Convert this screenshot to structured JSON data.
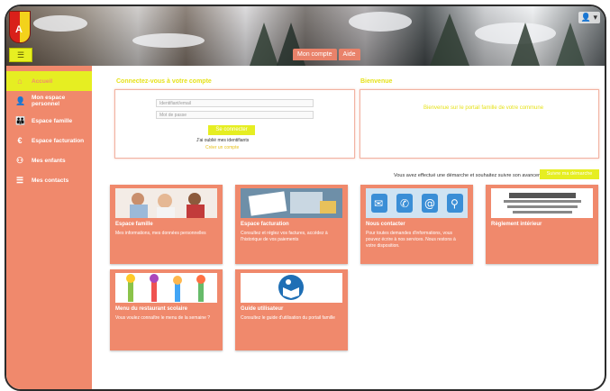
{
  "header": {
    "crest_letter": "A",
    "tabs": [
      "Mon compte",
      "Aide"
    ],
    "user_icon": "user-icon"
  },
  "sidebar": {
    "items": [
      {
        "label": "Accueil",
        "icon": "home-icon",
        "glyph": "⌂"
      },
      {
        "label": "Mon espace personnel",
        "icon": "person-icon",
        "glyph": "👤"
      },
      {
        "label": "Espace famille",
        "icon": "family-icon",
        "glyph": "👪"
      },
      {
        "label": "Espace facturation",
        "icon": "euro-icon",
        "glyph": "€"
      },
      {
        "label": "Mes enfants",
        "icon": "children-icon",
        "glyph": "⚇"
      },
      {
        "label": "Mes contacts",
        "icon": "list-icon",
        "glyph": "☰"
      }
    ]
  },
  "login": {
    "title": "Connectez-vous à votre compte",
    "username_placeholder": "Identifiant/email",
    "password_placeholder": "Mot de passe",
    "connect_label": "Se connecter",
    "forgot_label": "J'ai oublié mes identifiants",
    "signup_label": "Créer un compte"
  },
  "welcome": {
    "title": "Bienvenue",
    "message": "Bienvenue sur le portail famille de votre commune"
  },
  "notice": {
    "text": "Vous avez effectué une démarche et souhaitez suivre son avancement",
    "button": "Suivre ma démarche"
  },
  "tiles": [
    {
      "title": "Espace famille",
      "desc": "Mes informations, mes données personnelles"
    },
    {
      "title": "Espace facturation",
      "desc": "Consultez et réglez vos factures, accédez à l'historique de vos paiements"
    },
    {
      "title": "Nous contacter",
      "desc": "Pour toutes demandes d'informations, vous pouvez écrire à nos services. Nous restons à votre disposition."
    },
    {
      "title": "Règlement intérieur",
      "desc": ""
    },
    {
      "title": "Menu du restaurant scolaire",
      "desc": "Vous voulez connaître le menu de la semaine ?"
    },
    {
      "title": "Guide utilisateur",
      "desc": "Consultez le guide d'utilisation du portail famille"
    }
  ],
  "colors": {
    "accent": "#f0896c",
    "highlight": "#e6ee22"
  }
}
